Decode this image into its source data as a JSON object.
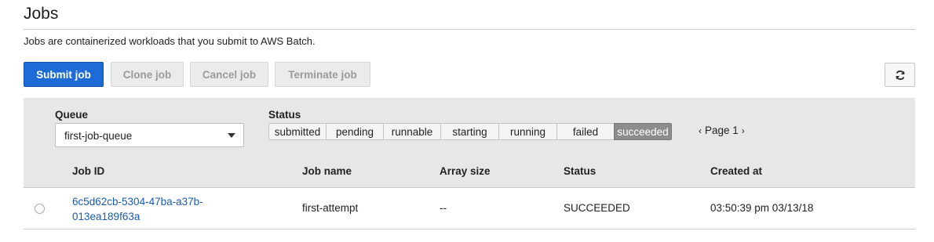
{
  "page": {
    "title": "Jobs",
    "description": "Jobs are containerized workloads that you submit to AWS Batch."
  },
  "toolbar": {
    "submit_label": "Submit job",
    "clone_label": "Clone job",
    "cancel_label": "Cancel job",
    "terminate_label": "Terminate job",
    "refresh_icon": "refresh-icon"
  },
  "filters": {
    "queue_label": "Queue",
    "queue_value": "first-job-queue",
    "status_label": "Status",
    "statuses": [
      "submitted",
      "pending",
      "runnable",
      "starting",
      "running",
      "failed",
      "succeeded"
    ],
    "selected_status": "succeeded"
  },
  "pagination": {
    "prev": "‹",
    "label": "Page 1",
    "next": "›"
  },
  "table": {
    "columns": [
      "Job ID",
      "Job name",
      "Array size",
      "Status",
      "Created at"
    ],
    "rows": [
      {
        "job_id_line1": "6c5d62cb-5304-47ba-a37b-",
        "job_id_line2": "013ea189f63a",
        "job_name": "first-attempt",
        "array_size": "--",
        "status": "SUCCEEDED",
        "created_at": "03:50:39 pm 03/13/18"
      }
    ]
  },
  "colors": {
    "primary": "#1e6bd8",
    "link": "#1a5bb0",
    "panel": "#e7e7e7",
    "selected_status": "#8c8c8c"
  }
}
